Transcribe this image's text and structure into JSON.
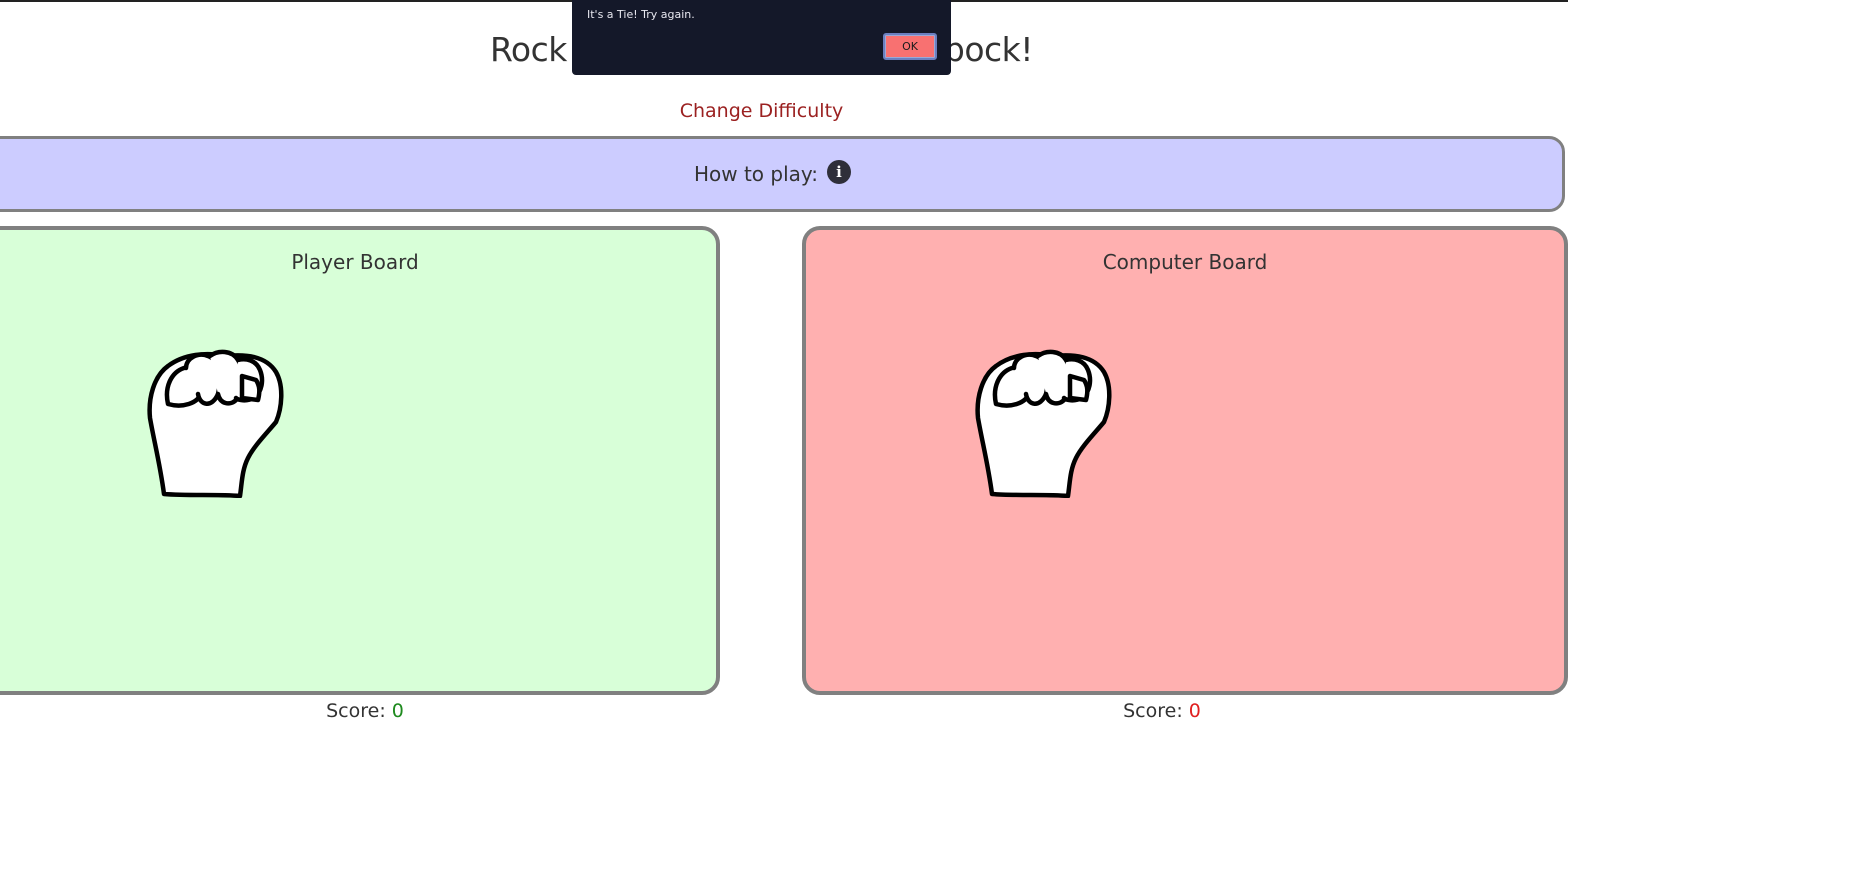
{
  "header": {
    "title": "Rock Paper Scissors Lizard Spock!",
    "change_difficulty": "Change Difficulty"
  },
  "how_to_play": {
    "label": "How to play:",
    "icon": "info-icon",
    "icon_glyph": "i"
  },
  "player_board": {
    "title": "Player Board",
    "choice": "rock",
    "choice_icon": "fist-icon",
    "score_label": "Score:",
    "score_value": "0",
    "background": "#d8ffd8"
  },
  "computer_board": {
    "title": "Computer Board",
    "choice": "rock",
    "choice_icon": "fist-icon",
    "score_label": "Score:",
    "score_value": "0",
    "background": "#ffb0b0"
  },
  "dialog": {
    "message": "It's a Tie! Try again.",
    "ok_label": "OK"
  },
  "colors": {
    "how_to_play_bg": "#ccccff",
    "difficulty_link": "#9b2121",
    "player_score": "#1e8a1e",
    "computer_score": "#e02020",
    "dialog_bg": "#141829",
    "ok_button": "#f87171"
  }
}
